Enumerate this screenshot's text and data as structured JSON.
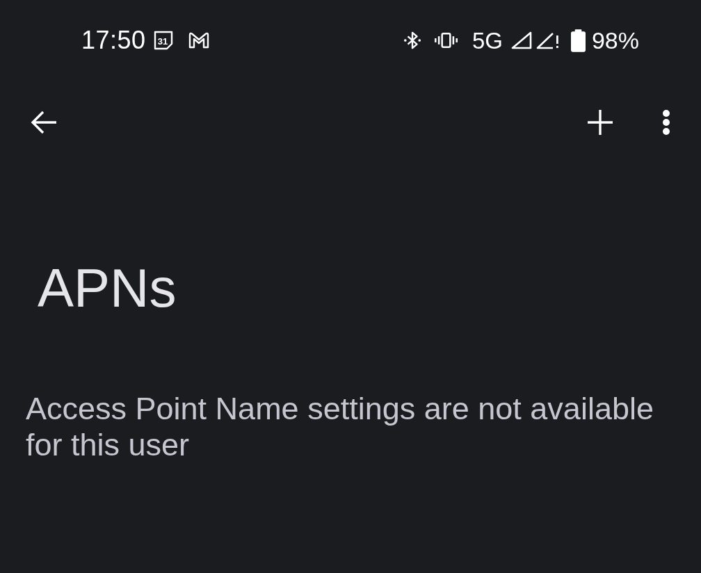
{
  "status_bar": {
    "time": "17:50",
    "calendar_date": "31",
    "network_type": "5G",
    "battery": "98%"
  },
  "page": {
    "title": "APNs",
    "message": "Access Point Name settings are not available for this user"
  }
}
